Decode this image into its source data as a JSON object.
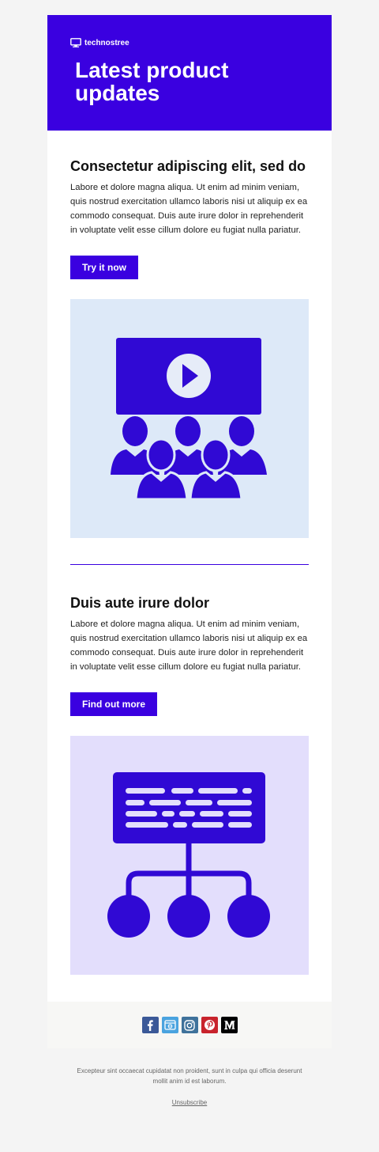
{
  "brand": {
    "name": "technostree",
    "icon": "monitor-icon"
  },
  "hero": {
    "title": "Latest product updates",
    "background": "#3a00e0"
  },
  "sections": [
    {
      "heading": "Consectetur adipiscing elit, sed do",
      "body": "Labore et dolore magna aliqua. Ut enim ad minim veniam, quis nostrud exercitation ullamco laboris nisi ut aliquip ex ea commodo consequat. Duis aute irure dolor in reprehenderit in voluptate velit esse cillum dolore eu fugiat nulla pariatur.",
      "button": "Try it now",
      "illustration": "video-presentation-audience-icon",
      "illustration_bg": "#dde9f8"
    },
    {
      "heading": "Duis aute irure dolor",
      "body": "Labore et dolore magna aliqua. Ut enim ad minim veniam, quis nostrud exercitation ullamco laboris nisi ut aliquip ex ea commodo consequat. Duis aute irure dolor in reprehenderit in voluptate velit esse cillum dolore eu fugiat nulla pariatur.",
      "button": "Find out more",
      "illustration": "network-hierarchy-icon",
      "illustration_bg": "#e3defc"
    }
  ],
  "social": [
    {
      "name": "facebook-icon",
      "color": "#3b5998"
    },
    {
      "name": "website-icon",
      "color": "#4aa3df"
    },
    {
      "name": "instagram-icon",
      "color": "#3f729b"
    },
    {
      "name": "pinterest-icon",
      "color": "#c8232c"
    },
    {
      "name": "medium-icon",
      "color": "#000000"
    }
  ],
  "footer": {
    "text": "Excepteur sint occaecat cupidatat non proident, sunt in culpa qui officia deserunt mollit anim id est laborum.",
    "unsubscribe": "Unsubscribe"
  },
  "accent": "#3a00e0",
  "illustration_color": "#3009d4"
}
